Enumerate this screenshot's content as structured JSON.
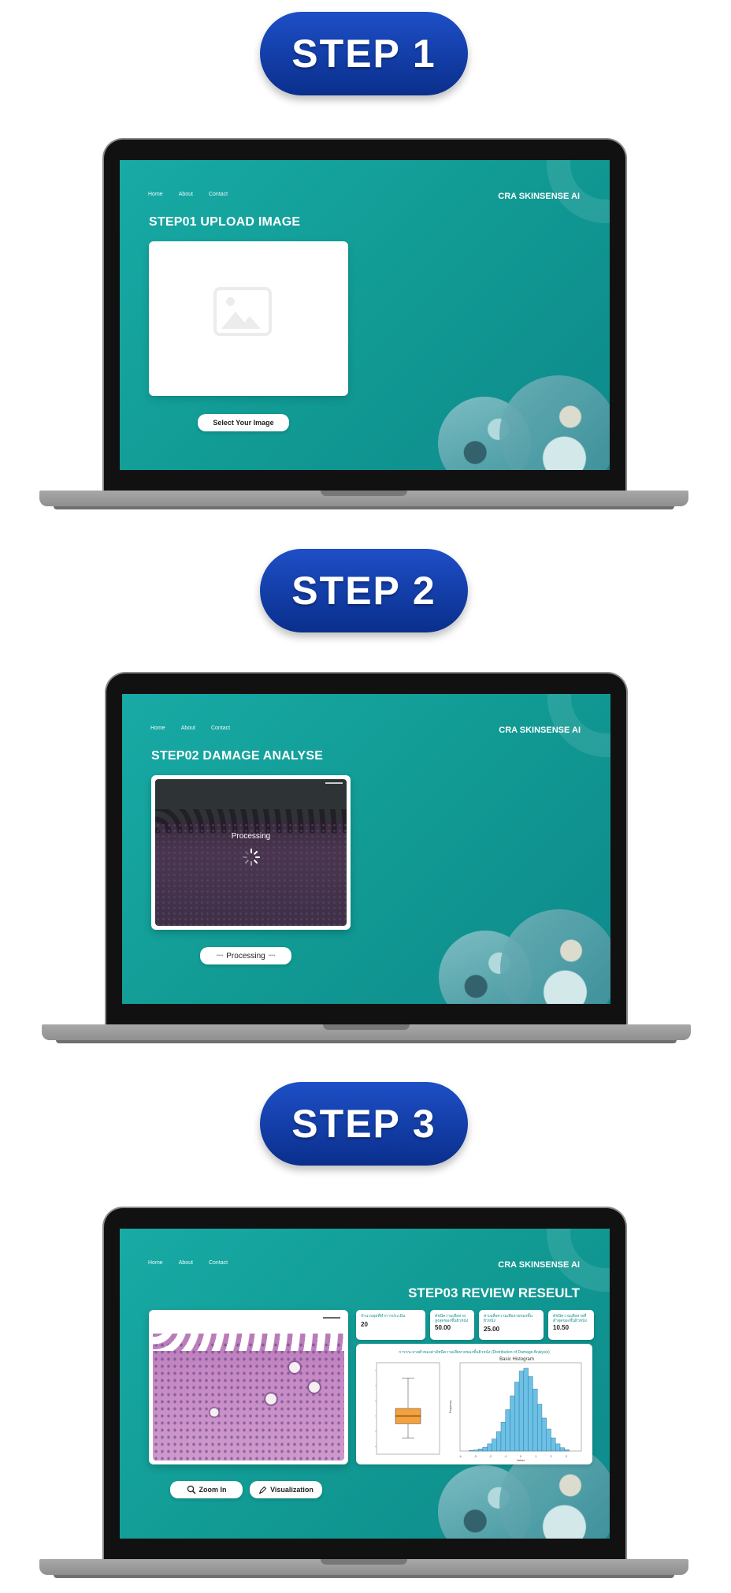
{
  "steps": [
    {
      "pill": "STEP 1",
      "nav": [
        "Home",
        "About",
        "Contact"
      ],
      "brand": "CRA SKINSENSE AI",
      "title": "STEP01 UPLOAD IMAGE",
      "button": "Select Your Image"
    },
    {
      "pill": "STEP 2",
      "nav": [
        "Home",
        "About",
        "Contact"
      ],
      "brand": "CRA SKINSENSE AI",
      "title": "STEP02 DAMAGE ANALYSE",
      "processing_text": "Processing",
      "button": "Processing"
    },
    {
      "pill": "STEP 3",
      "nav": [
        "Home",
        "About",
        "Contact"
      ],
      "brand": "CRA SKINSENSE AI",
      "title": "STEP03 REVIEW RESEULT",
      "stats": [
        {
          "label": "จำนวนจุดที่ทำการประเมิน",
          "value": "20"
        },
        {
          "label": "ดัชนีความเสียหายสูงสุดของชั้นผิวหนัง",
          "value": "50.00"
        },
        {
          "label": "ค่าเฉลี่ยความเสียหายของชั้นผิวหนัง",
          "value": "25.00"
        },
        {
          "label": "ดัชนีความเสียหายที่ต่ำสุดของชั้นผิวหนัง",
          "value": "10.50"
        }
      ],
      "chart_card_title": "การกระจายตัวของค่าดัชนีความเสียหายของชั้นผิวหนัง (Distribution of Damage Analysis)",
      "zoom_button": "Zoom In",
      "viz_button": "Visualization"
    }
  ],
  "chart_data": [
    {
      "type": "box",
      "title": "",
      "whisker_low": 10.5,
      "q1": 20,
      "median": 25,
      "q3": 30,
      "whisker_high": 50,
      "color": "#f7a13a"
    },
    {
      "type": "bar",
      "title": "Basic Histogram",
      "xlabel": "Values",
      "ylabel": "Frequency",
      "xlim": [
        -4,
        4
      ],
      "ylim": [
        0,
        320
      ],
      "xticks": [
        "-4",
        "-3",
        "-2",
        "-1",
        "0",
        "1",
        "2",
        "3"
      ],
      "bins": [
        -3.4,
        -3.1,
        -2.8,
        -2.5,
        -2.2,
        -1.9,
        -1.6,
        -1.3,
        -1.0,
        -0.7,
        -0.4,
        -0.1,
        0.2,
        0.5,
        0.8,
        1.1,
        1.4,
        1.7,
        2.0,
        2.3,
        2.6,
        2.9
      ],
      "values": [
        2,
        4,
        8,
        14,
        26,
        44,
        70,
        105,
        150,
        200,
        250,
        290,
        300,
        270,
        225,
        170,
        120,
        80,
        48,
        26,
        12,
        5
      ],
      "color": "#6cc1e6"
    }
  ],
  "colors": {
    "pill": "#0a2f8c",
    "teal": "#13a09c",
    "stat_label": "#17908d",
    "box_fill": "#f7a13a",
    "hist_fill": "#6cc1e6"
  }
}
